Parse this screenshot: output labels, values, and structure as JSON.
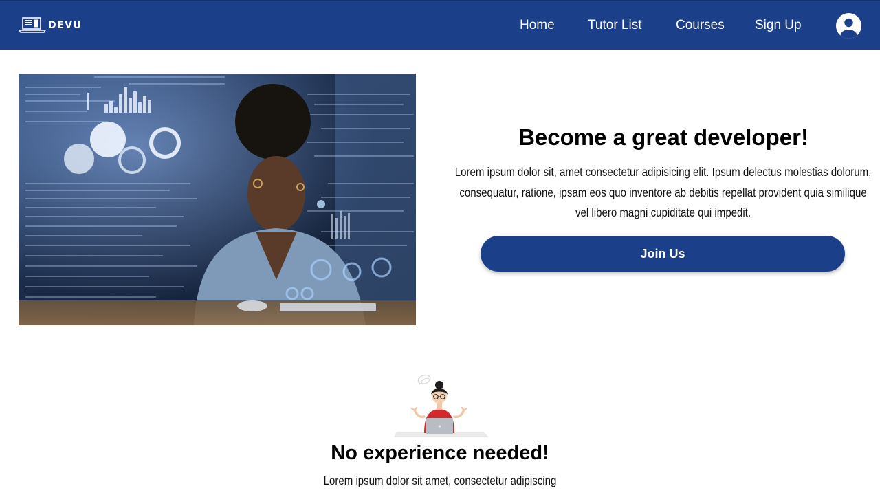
{
  "navbar": {
    "brand": "DEVU",
    "links": {
      "home": "Home",
      "tutors": "Tutor List",
      "courses": "Courses",
      "signup": "Sign Up"
    },
    "avatar_icon": "user-circle-icon",
    "brand_icon": "laptop-icon",
    "background": "#1c3f8a"
  },
  "hero": {
    "title": "Become a great developer!",
    "text": "Lorem ipsum dolor sit, amet consectetur adipisicing elit. Ipsum delectus molestias dolorum, consequatur, ratione, ipsam eos quo inventore ab debitis repellat provident quia similique vel libero magni cupiditate qui impedit.",
    "button": "Join Us",
    "accent": "#1c3f8a"
  },
  "section2": {
    "title": "No experience needed!",
    "text": "Lorem ipsum dolor sit amet, consectetur adipiscing"
  }
}
